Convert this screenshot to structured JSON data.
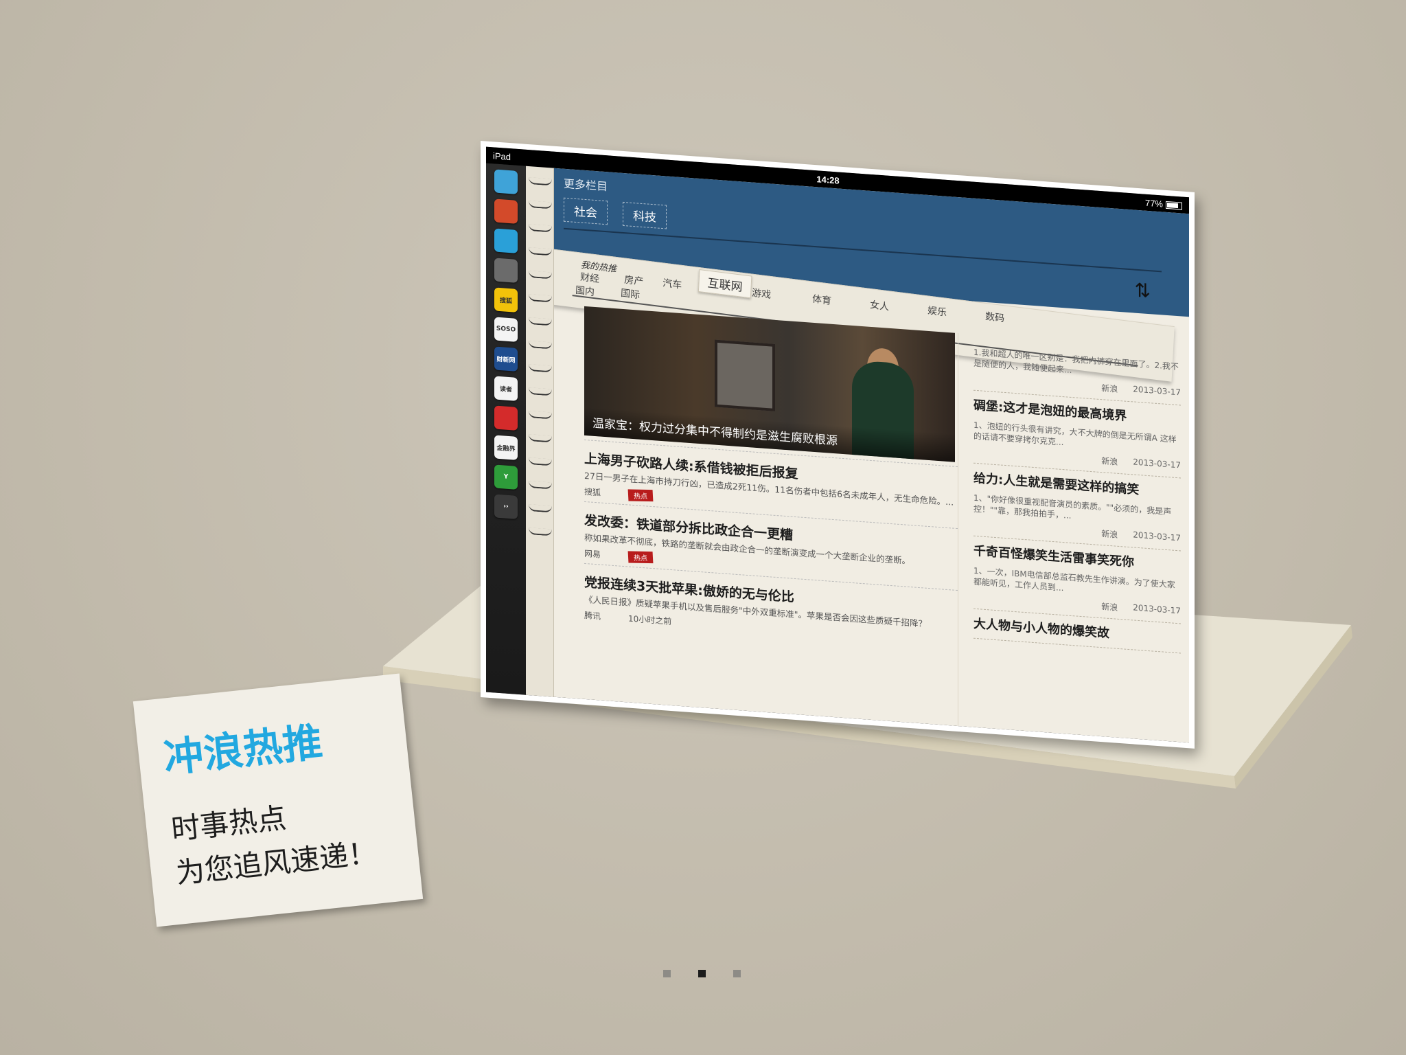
{
  "statusbar": {
    "device": "iPad",
    "time": "14:28",
    "battery": "77%"
  },
  "dock": {
    "icons": [
      {
        "name": "home-shell-icon",
        "label": "",
        "color": "#3fa3d8"
      },
      {
        "name": "hot-fire-icon",
        "label": "",
        "color": "#d34a2a"
      },
      {
        "name": "cloud-icon",
        "label": "",
        "color": "#2aa0d8"
      },
      {
        "name": "news-stack-icon",
        "label": "",
        "color": "#6b6b6b"
      },
      {
        "name": "sohu-icon",
        "label": "搜狐",
        "color": "#f2c20a"
      },
      {
        "name": "soso-icon",
        "label": "SOSO",
        "color": "#f4f4f4"
      },
      {
        "name": "caixin-icon",
        "label": "财新网",
        "color": "#1f4d8f"
      },
      {
        "name": "duzhe-icon",
        "label": "读者",
        "color": "#f3f3f3"
      },
      {
        "name": "kuangfang-icon",
        "label": "",
        "color": "#d42b2b"
      },
      {
        "name": "jinrong-icon",
        "label": "金融界",
        "color": "#f3f3f3"
      },
      {
        "name": "y-icon",
        "label": "Y",
        "color": "#2e9c3a"
      },
      {
        "name": "more-apps-icon",
        "label": "››",
        "color": "#3a3a3a"
      }
    ]
  },
  "topnav": {
    "more_label": "更多栏目",
    "categories": [
      "社会",
      "科技"
    ]
  },
  "fold": {
    "my_recommend": "我的热推",
    "active_tag": "互联网",
    "tags_row1": [
      "财经",
      "房产",
      "汽车"
    ],
    "tags_row2": [
      "国内",
      "国际",
      "游戏",
      "体育",
      "女人",
      "娱乐",
      "数码"
    ]
  },
  "hero": {
    "caption": "温家宝：权力过分集中不得制约是滋生腐败根源"
  },
  "news": [
    {
      "title": "上海男子砍路人续:系借钱被拒后报复",
      "summary": "27日一男子在上海市持刀行凶，已造成2死11伤。11名伤者中包括6名未成年人，无生命危险。...",
      "source": "搜狐",
      "badge": "热点"
    },
    {
      "title": "发改委：铁道部分拆比政企合一更糟",
      "summary": "称如果改革不彻底，铁路的垄断就会由政企合一的垄断演变成一个大垄断企业的垄断。",
      "source": "网易",
      "badge": "热点"
    },
    {
      "title": "党报连续3天批苹果:傲娇的无与伦比",
      "summary": "《人民日报》质疑苹果手机以及售后服务\"中外双重标准\"。苹果是否会因这些质疑千招降？",
      "source": "腾讯",
      "time": "10小时之前"
    }
  ],
  "side": [
    {
      "title": "",
      "summary": "1.我和超人的唯一区别是：我把内裤穿在里面了。2.我不是随便的人，我随便起来...",
      "source": "新浪",
      "date": "2013-03-17"
    },
    {
      "title": "碉堡:这才是泡妞的最高境界",
      "summary": "1、泡妞的行头很有讲究，大不大牌的倒是无所谓A 这样的话请不要穿拷尔克克...",
      "source": "新浪",
      "date": "2013-03-17"
    },
    {
      "title": "给力:人生就是需要这样的搞笑",
      "summary": "1、\"你好像很重视配音演员的素质。\"\"必须的，我是声控！\"\"靠，那我拍拍手，...",
      "source": "新浪",
      "date": "2013-03-17"
    },
    {
      "title": "千奇百怪爆笑生活雷事笑死你",
      "summary": "1、一次，IBM电信部总监石教先生作讲演。为了使大家都能听见，工作人员到...",
      "source": "新浪",
      "date": "2013-03-17"
    },
    {
      "title": "大人物与小人物的爆笑故",
      "summary": "",
      "source": "",
      "date": ""
    }
  ],
  "note": {
    "title": "冲浪热推",
    "line1": "时事热点",
    "line2": "为您追风速递！"
  },
  "pager": {
    "count": 3,
    "active": 1
  }
}
